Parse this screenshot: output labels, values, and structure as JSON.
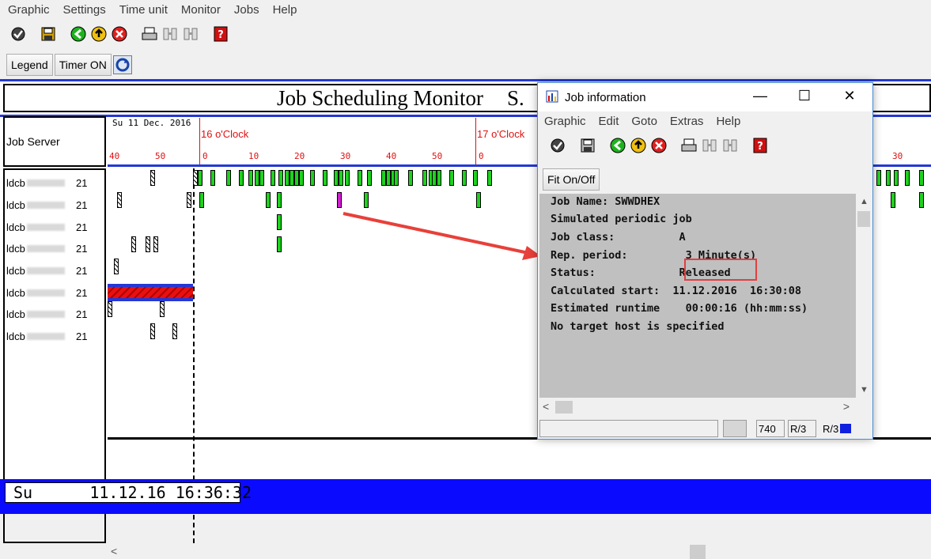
{
  "menu": [
    "Graphic",
    "Settings",
    "Time unit",
    "Monitor",
    "Jobs",
    "Help"
  ],
  "buttons": {
    "legend": "Legend",
    "timer": "Timer ON"
  },
  "chart": {
    "title": "Job Scheduling Monitor",
    "title_tail": "S.",
    "server_header": "Job Server",
    "date": "Su 11 Dec. 2016",
    "hours": [
      "16 o'Clock",
      "17 o'Clock"
    ],
    "ticks": [
      "40",
      "50",
      "0",
      "10",
      "20",
      "30",
      "40",
      "50",
      "0",
      "30"
    ],
    "servers": [
      {
        "prefix": "ldcb",
        "num": "21"
      },
      {
        "prefix": "ldcb",
        "num": "21"
      },
      {
        "prefix": "ldcb",
        "num": "21"
      },
      {
        "prefix": "ldcb",
        "num": "21"
      },
      {
        "prefix": "ldcb",
        "num": "21"
      },
      {
        "prefix": "ldcb",
        "num": "21"
      },
      {
        "prefix": "ldcb",
        "num": "21"
      },
      {
        "prefix": "ldcb",
        "num": "21"
      }
    ]
  },
  "status_bar": {
    "text": "Su      11.12.16 16:36:32"
  },
  "dialog": {
    "title": "Job information",
    "menu": [
      "Graphic",
      "Edit",
      "Goto",
      "Extras",
      "Help"
    ],
    "fit_button": "Fit On/Off",
    "lines": [
      "Job Name: SWWDHEX",
      "Simulated periodic job",
      "Job class:          A",
      "Rep. period:         3 Minute(s)",
      "Status:             Released",
      "Calculated start:  11.12.2016  16:30:08",
      "Estimated runtime    00:00:16 (hh:mm:ss)",
      "No target host is specified"
    ],
    "status": {
      "field2": "740",
      "field3": "R/3",
      "field4": "R/3"
    }
  },
  "colors": {
    "accent_blue": "#2438d6",
    "job_green": "#1ed21e",
    "timeline_red": "#e01010",
    "highlight": "#e04040"
  },
  "icons": [
    "check-icon",
    "save-icon",
    "back-icon",
    "exit-icon",
    "cancel-icon",
    "print-icon",
    "find-icon",
    "find-next-icon",
    "help-icon",
    "refresh-icon"
  ]
}
